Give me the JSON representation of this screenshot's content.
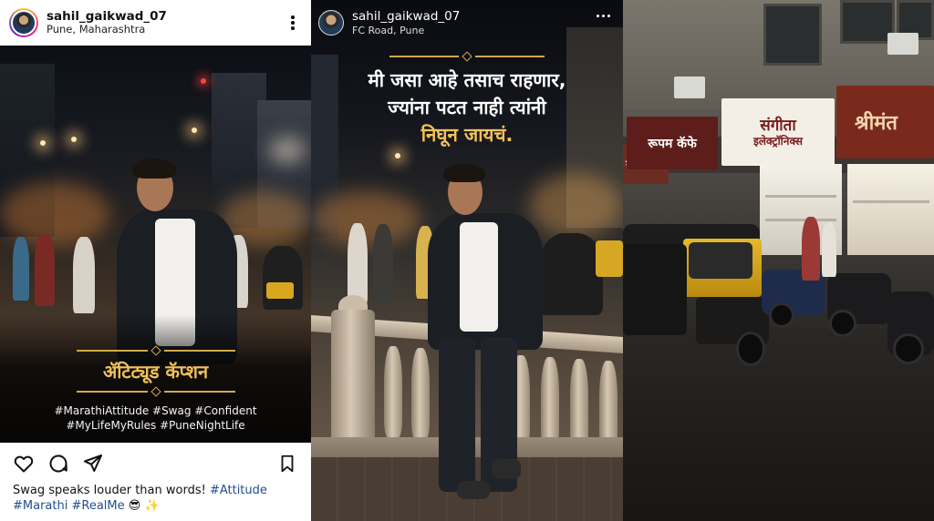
{
  "post": {
    "username": "sahil_gaikwad_07",
    "location": "Pune, Maharashtra",
    "overlay_title": "ॲटिट्यूड कॅप्शन",
    "overlay_hashtags_line1": "#MarathiAttitude #Swag #Confident",
    "overlay_hashtags_line2": "#MyLifeMyRules #PuneNightLife",
    "caption_text": "Swag speaks louder than words! ",
    "caption_tag1": "#Attitude",
    "caption_tag2": "#Marathi",
    "caption_tag3": "#RealMe",
    "caption_emoji": "😎 ✨"
  },
  "story": {
    "username": "sahil_gaikwad_07",
    "location": "FC Road, Pune",
    "quote_line1": "मी जसा आहे तसाच राहणार,",
    "quote_line2": "ज्यांना पटत नाही त्यांनी",
    "quote_line3": "निघून जायचं."
  },
  "street": {
    "sign1": "रूपम कॅफे",
    "sign2_line1": "संगीता",
    "sign2_line2": "इलेक्ट्रॉनिक्स",
    "sign3": "श्रीमंत",
    "sign4": "रूपम कॅ"
  },
  "colors": {
    "accent_gold": "#f2c25a",
    "link_blue": "#1f4f8f"
  },
  "icons": [
    "more-vertical-icon",
    "heart-icon",
    "comment-icon",
    "share-icon",
    "bookmark-icon",
    "more-horizontal-icon"
  ]
}
